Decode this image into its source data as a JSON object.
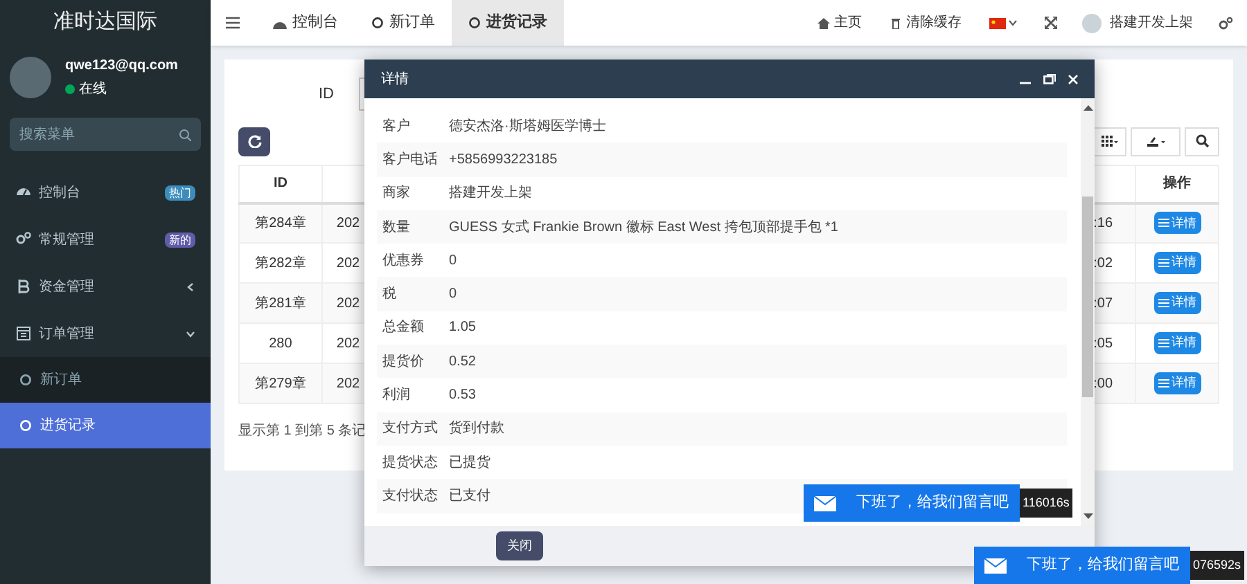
{
  "sidebar": {
    "logo": "准时达国际",
    "user": {
      "email": "qwe123@qq.com",
      "status": "在线"
    },
    "search": {
      "placeholder": "搜索菜单"
    },
    "items": [
      {
        "label": "控制台",
        "badge": "热门",
        "color": "#3c8dbc",
        "selected": false
      },
      {
        "label": "常规管理",
        "badge": "新的",
        "color": "#605ca8",
        "selected": false
      },
      {
        "label": "资金管理",
        "expanded": false,
        "selected": false
      },
      {
        "label": "订单管理",
        "expanded": true,
        "selected": false,
        "children": [
          {
            "label": "新订单",
            "selected": false
          },
          {
            "label": "进货记录",
            "selected": true
          }
        ]
      }
    ]
  },
  "top_bar": {
    "tabs": [
      {
        "label": "控制台",
        "selected": false
      },
      {
        "label": "新订单",
        "selected": false
      },
      {
        "label": "进货记录",
        "selected": true
      }
    ],
    "links": [
      "主页",
      "清除缓存"
    ],
    "user_name": "搭建开发上架"
  },
  "search_form": {
    "label": "ID"
  },
  "table": {
    "columns": [
      "ID",
      "操作"
    ],
    "rows": [
      {
        "id": "第284章",
        "column_2": "202",
        "column_3": ":16",
        "action": "详情"
      },
      {
        "id": "第282章",
        "column_2": "202",
        "column_3": ":02",
        "action": "详情"
      },
      {
        "id": "第281章",
        "column_2": "202",
        "column_3": ":07",
        "action": "详情"
      },
      {
        "id": "280",
        "column_2": "202",
        "column_3": ":05",
        "action": "详情"
      },
      {
        "id": "第279章",
        "column_2": "202",
        "column_3": ":00",
        "action": "详情"
      }
    ],
    "footer": "显示第 1 到第 5 条记"
  },
  "modal": {
    "title": "详情",
    "rows": [
      {
        "label": "客户",
        "value": "德安杰洛·斯塔姆医学博士"
      },
      {
        "label": "客户电话",
        "value": "+5856993223185"
      },
      {
        "label": "商家",
        "value": "搭建开发上架"
      },
      {
        "label": "数量",
        "value": "GUESS 女式 Frankie Brown 徽标 East West 挎包顶部提手包 *1"
      },
      {
        "label": "优惠券",
        "value": "0"
      },
      {
        "label": "税",
        "value": "0"
      },
      {
        "label": "总金额",
        "value": "1.05"
      },
      {
        "label": "提货价",
        "value": "0.52"
      },
      {
        "label": "利润",
        "value": "0.53"
      },
      {
        "label": "支付方式",
        "value": "货到付款"
      },
      {
        "label": "提货状态",
        "value": "已提货"
      },
      {
        "label": "支付状态",
        "value": "已支付"
      }
    ],
    "button": "关闭"
  },
  "chat_widgets": [
    {
      "text": "下班了，给我们留言吧",
      "timer": "116016s"
    },
    {
      "text": "下班了，给我们留言吧",
      "timer": "076592s"
    }
  ]
}
